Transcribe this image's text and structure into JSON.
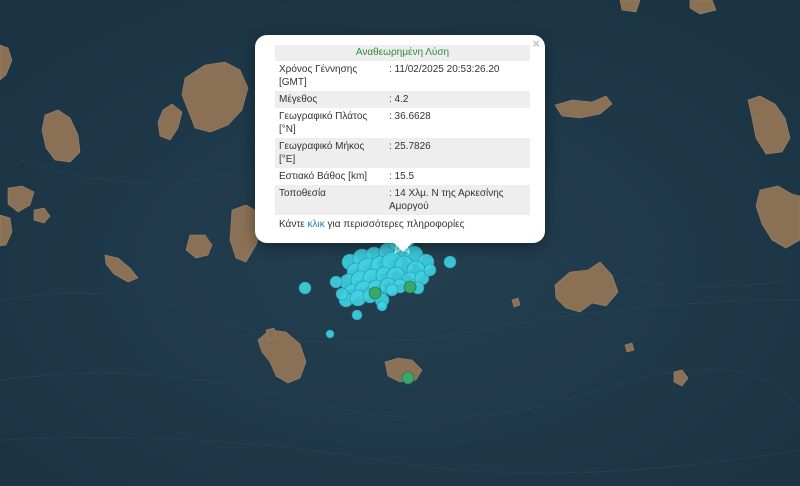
{
  "popup": {
    "title": "Αναθεωρημένη Λύση",
    "close_label": "×",
    "rows": [
      {
        "label": "Χρόνος Γέννησης [GMT]",
        "value": ": 11/02/2025 20:53:26.20"
      },
      {
        "label": "Μέγεθος",
        "value": ": 4.2"
      },
      {
        "label": "Γεωγραφικό Πλάτος [°N]",
        "value": ": 36.6628"
      },
      {
        "label": "Γεωγραφικό Μήκος [°E]",
        "value": ": 25.7826"
      },
      {
        "label": "Εστιακό Βάθος [km]",
        "value": ": 15.5"
      },
      {
        "label": "Τοποθεσία",
        "value": ": 14 Χλμ. Ν της Αρκεσίνης Αμοργού"
      }
    ],
    "more_prefix": "Κάντε ",
    "more_link": "κλικ",
    "more_suffix": " για περισσότερες πληροφορίες"
  },
  "colors": {
    "sea": "#1f3a4a",
    "land": "#8a7156",
    "quake_recent": "#3fd3e2",
    "quake_older": "#35a86a"
  },
  "icons": {
    "close": "close-icon"
  }
}
